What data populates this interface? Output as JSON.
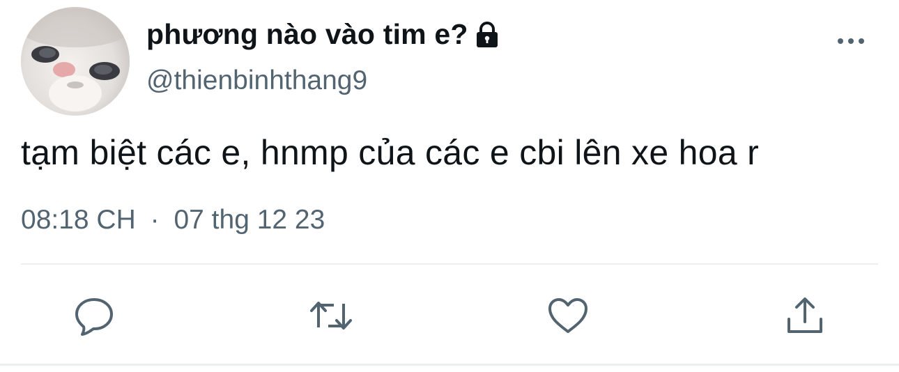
{
  "tweet": {
    "author": {
      "display_name": "phương nào vào tim e?",
      "handle": "@thienbinhthang9",
      "protected_icon": "lock-icon",
      "avatar": "cat-avatar"
    },
    "text": "tạm biệt các e, hnmp của các e cbi lên xe hoa r",
    "time": "08:18 CH",
    "separator": "·",
    "date": "07 thg 12 23"
  },
  "actions": {
    "more": "more-horizontal-icon",
    "reply": "reply-icon",
    "retweet": "retweet-icon",
    "like": "heart-icon",
    "share": "share-icon"
  },
  "colors": {
    "text_primary": "#0f1419",
    "text_secondary": "#536471",
    "divider": "#eceef0"
  }
}
